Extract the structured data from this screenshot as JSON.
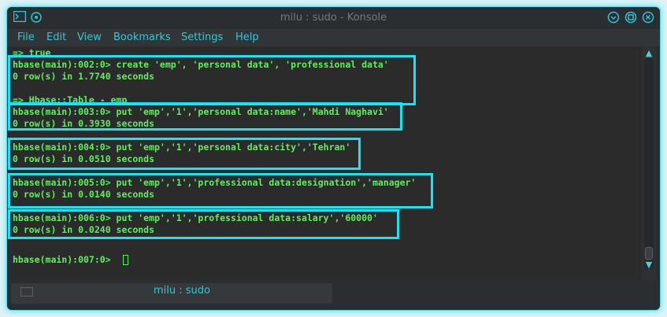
{
  "window": {
    "title": "milu : sudo - Konsole",
    "buttons": [
      "minimize-icon",
      "maximize-icon",
      "close-icon"
    ]
  },
  "menu": [
    "File",
    "Edit",
    "View",
    "Bookmarks",
    "Settings",
    "Help"
  ],
  "terminal": {
    "lines": [
      "=> true",
      "hbase(main):002:0> create 'emp', 'personal data', 'professional data'",
      "0 row(s) in 1.7740 seconds",
      "",
      "=> Hbase::Table - emp",
      "hbase(main):003:0> put 'emp','1','personal data:name','Mahdi Naghavi'",
      "0 row(s) in 0.3930 seconds",
      "",
      "hbase(main):004:0> put 'emp','1','personal data:city','Tehran'",
      "0 row(s) in 0.0510 seconds",
      "",
      "hbase(main):005:0> put 'emp','1','professional data:designation','manager'",
      "0 row(s) in 0.0140 seconds",
      "",
      "hbase(main):006:0> put 'emp','1','professional data:salary','60000'",
      "0 row(s) in 0.0240 seconds",
      "",
      "hbase(main):007:0> "
    ]
  },
  "tab": {
    "label": "milu : sudo"
  },
  "colors": {
    "accent": "#16e6f4",
    "terminal_text": "#5df05d",
    "terminal_bg": "#2b2b2b"
  }
}
